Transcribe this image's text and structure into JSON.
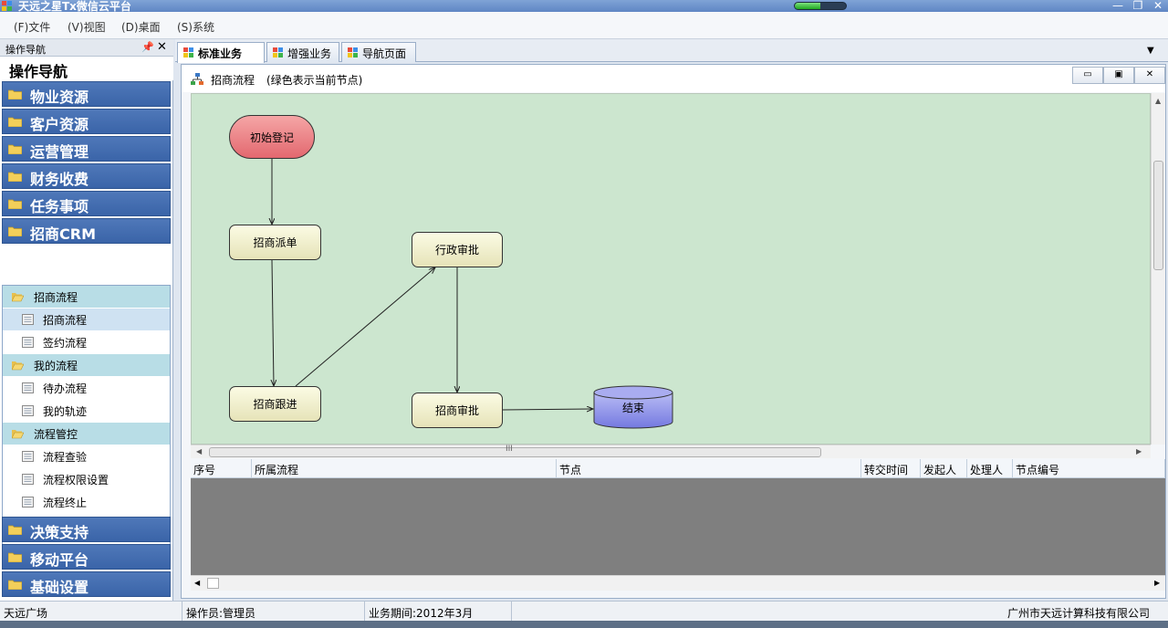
{
  "window": {
    "title": "天远之星Tx微信云平台",
    "progress_fraction": 0.5,
    "controls": {
      "minimize": "—",
      "restore": "❐",
      "close": "✕"
    }
  },
  "menu": [
    {
      "label": "(F)文件"
    },
    {
      "label": "(V)视图"
    },
    {
      "label": "(D)桌面"
    },
    {
      "label": "(S)系统"
    }
  ],
  "nav": {
    "header_label": "操作导航",
    "pin_icon": "📌",
    "close_icon": "✕",
    "title": "操作导航",
    "groups_top": [
      {
        "label": "物业资源"
      },
      {
        "label": "客户资源"
      },
      {
        "label": "运营管理"
      },
      {
        "label": "财务收费"
      },
      {
        "label": "任务事项"
      },
      {
        "label": "招商CRM"
      }
    ],
    "sub_items": [
      {
        "label": "招商流程",
        "kind": "category"
      },
      {
        "label": "招商流程",
        "kind": "item",
        "selected": true
      },
      {
        "label": "签约流程",
        "kind": "item"
      },
      {
        "label": "我的流程",
        "kind": "category"
      },
      {
        "label": "待办流程",
        "kind": "item"
      },
      {
        "label": "我的轨迹",
        "kind": "item"
      },
      {
        "label": "流程管控",
        "kind": "category"
      },
      {
        "label": "流程查验",
        "kind": "item"
      },
      {
        "label": "流程权限设置",
        "kind": "item"
      },
      {
        "label": "流程终止",
        "kind": "item"
      }
    ],
    "groups_bottom": [
      {
        "label": "决策支持"
      },
      {
        "label": "移动平台"
      },
      {
        "label": "基础设置"
      }
    ]
  },
  "tabs": [
    {
      "label": "标准业务",
      "active": true
    },
    {
      "label": "增强业务",
      "active": false
    },
    {
      "label": "导航页面",
      "active": false
    }
  ],
  "tab_dropdown": "▼",
  "document": {
    "title": "招商流程",
    "hint": "(绿色表示当前节点)",
    "controls": {
      "minimize": "▭",
      "restore": "▣",
      "close": "✕"
    }
  },
  "flowchart": {
    "nodes": [
      {
        "id": "start",
        "label": "初始登记",
        "kind": "start"
      },
      {
        "id": "dispatch",
        "label": "招商派单",
        "kind": "step"
      },
      {
        "id": "follow",
        "label": "招商跟进",
        "kind": "step"
      },
      {
        "id": "admin",
        "label": "行政审批",
        "kind": "step"
      },
      {
        "id": "approve",
        "label": "招商审批",
        "kind": "step"
      },
      {
        "id": "end",
        "label": "结束",
        "kind": "end"
      }
    ],
    "edges": [
      {
        "from": "start",
        "to": "dispatch"
      },
      {
        "from": "dispatch",
        "to": "follow"
      },
      {
        "from": "follow",
        "to": "admin"
      },
      {
        "from": "admin",
        "to": "approve"
      },
      {
        "from": "approve",
        "to": "end"
      }
    ]
  },
  "grid": {
    "columns": [
      {
        "label": "序号"
      },
      {
        "label": "所属流程"
      },
      {
        "label": "节点"
      },
      {
        "label": "转交时间"
      },
      {
        "label": "发起人"
      },
      {
        "label": "处理人"
      },
      {
        "label": "节点编号"
      }
    ]
  },
  "scroll_glyphs": {
    "up": "▲",
    "left": "◀",
    "right": "▶",
    "grip": "III"
  },
  "status": {
    "location": "天远广场",
    "operator": "操作员:管理员",
    "period": "业务期间:2012年3月",
    "company": "广州市天远计算科技有限公司"
  },
  "colors": {
    "nav_group": "#4670b3",
    "canvas_bg": "#cce6cf",
    "start_node": "#e3686f",
    "step_node": "#eeecc8",
    "end_node": "#8a8ee6",
    "grid_bg": "#7f7f7f",
    "category_row": "#b8dde6"
  }
}
